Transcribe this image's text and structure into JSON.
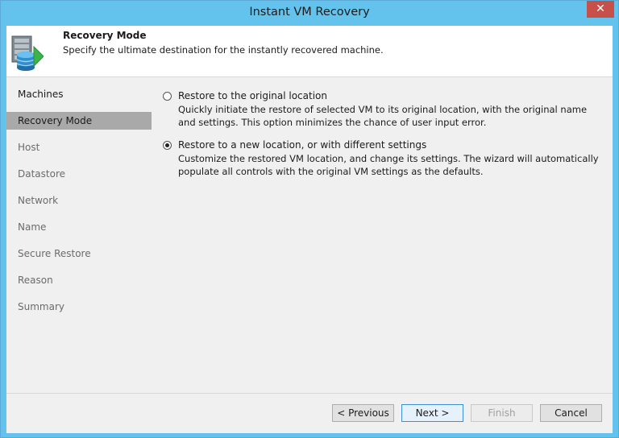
{
  "window": {
    "title": "Instant VM Recovery",
    "close_glyph": "✕"
  },
  "header": {
    "title": "Recovery Mode",
    "subtitle": "Specify the ultimate destination for the instantly recovered machine.",
    "icon": "server-database-restore-icon"
  },
  "steps": [
    {
      "label": "Machines",
      "state": "done"
    },
    {
      "label": "Recovery Mode",
      "state": "active"
    },
    {
      "label": "Host",
      "state": "pending"
    },
    {
      "label": "Datastore",
      "state": "pending"
    },
    {
      "label": "Network",
      "state": "pending"
    },
    {
      "label": "Name",
      "state": "pending"
    },
    {
      "label": "Secure Restore",
      "state": "pending"
    },
    {
      "label": "Reason",
      "state": "pending"
    },
    {
      "label": "Summary",
      "state": "pending"
    }
  ],
  "options": [
    {
      "label": "Restore to the original location",
      "description": "Quickly initiate the restore of selected VM to its original location, with the original name and settings. This option minimizes the chance of user input error.",
      "selected": false
    },
    {
      "label": "Restore to a new location, or with different settings",
      "description": "Customize the restored VM location, and change its settings. The wizard will automatically populate all controls with the original VM settings as the defaults.",
      "selected": true
    }
  ],
  "buttons": {
    "previous": "< Previous",
    "next": "Next >",
    "finish": "Finish",
    "cancel": "Cancel"
  },
  "colors": {
    "title_bar": "#63c3ec",
    "close_button": "#c7504b",
    "active_step": "#a9a9a9"
  }
}
